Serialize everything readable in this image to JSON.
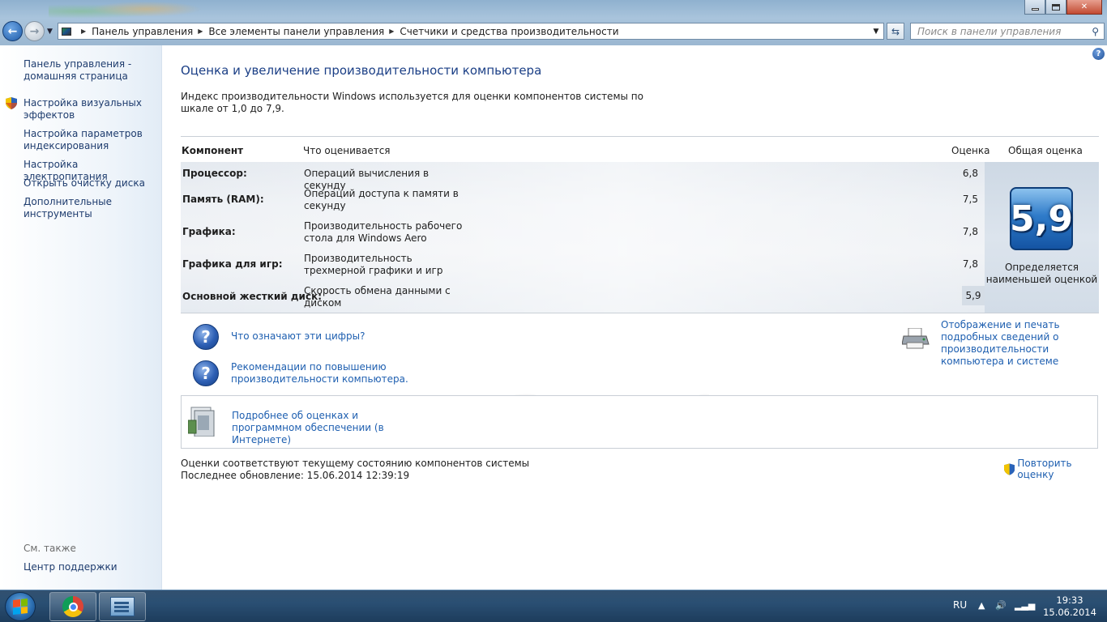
{
  "address_bar": {
    "crumbs": [
      "Панель управления",
      "Все элементы панели управления",
      "Счетчики и средства производительности"
    ],
    "search_placeholder": "Поиск в панели управления"
  },
  "sidebar": {
    "home_link": "Панель управления - домашняя страница",
    "links": [
      "Настройка визуальных эффектов",
      "Настройка параметров индексирования",
      "Настройка электропитания",
      "Открыть очистку диска",
      "Дополнительные инструменты"
    ],
    "see_also_label": "См. также",
    "see_also_links": [
      "Центр поддержки"
    ]
  },
  "main": {
    "title": "Оценка и увеличение производительности компьютера",
    "intro": "Индекс производительности Windows используется для оценки компонентов системы по шкале от 1,0 до 7,9."
  },
  "table": {
    "headers": {
      "component": "Компонент",
      "what": "Что оценивается",
      "score": "Оценка",
      "base": "Общая оценка"
    },
    "rows": [
      {
        "component": "Процессор:",
        "what": "Операций вычисления в секунду",
        "score": "6,8"
      },
      {
        "component": "Память (RAM):",
        "what": "Операций доступа к памяти в секунду",
        "score": "7,5"
      },
      {
        "component": "Графика:",
        "what": "Производительность рабочего стола для Windows Aero",
        "score": "7,8"
      },
      {
        "component": "Графика для игр:",
        "what": "Производительность трехмерной графики и игр",
        "score": "7,8"
      },
      {
        "component": "Основной жесткий диск:",
        "what": "Скорость обмена данными с диском",
        "score": "5,9"
      }
    ],
    "base_score": "5,9",
    "base_note": "Определяется наименьшей оценкой"
  },
  "links": {
    "what_numbers": "Что означают эти цифры?",
    "tips": "Рекомендации по повышению производительности компьютера.",
    "print_details": "Отображение и печать подробных сведений о производительности компьютера и системе",
    "learn_more": "Подробнее об оценках и программном обеспечении (в Интернете)"
  },
  "status": {
    "current": "Оценки соответствуют текущему состоянию компонентов системы",
    "last_update": "Последнее обновление: 15.06.2014 12:39:19",
    "rerun": "Повторить оценку"
  },
  "taskbar": {
    "language": "RU",
    "time": "19:33",
    "date": "15.06.2014"
  },
  "colors": {
    "link": "#1e5fb0",
    "title": "#1b3f86",
    "badge": "#2f7bc9"
  }
}
